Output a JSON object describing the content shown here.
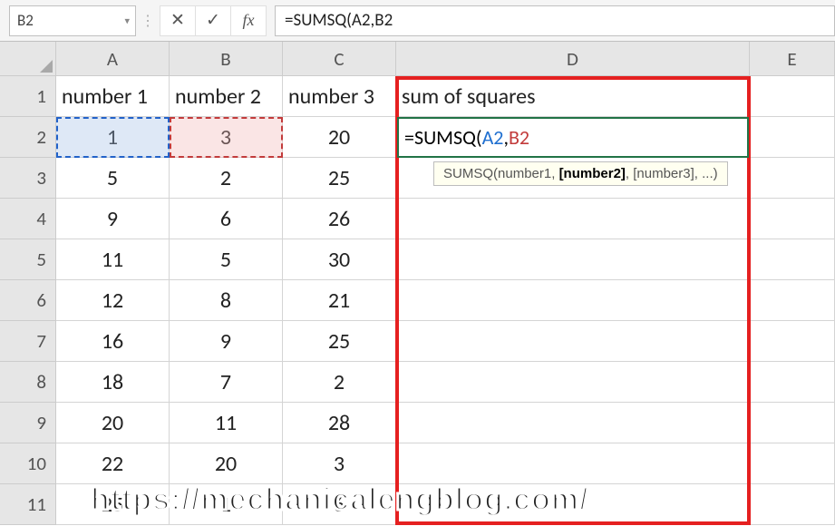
{
  "formula_bar": {
    "name_box": "B2",
    "cancel_glyph": "✕",
    "enter_glyph": "✓",
    "fx_glyph": "fx",
    "formula_text": "=SUMSQ(A2,B2"
  },
  "columns": [
    "A",
    "B",
    "C",
    "D",
    "E"
  ],
  "col_widths": [
    "wA",
    "wB",
    "wC",
    "wD",
    "wE"
  ],
  "rows": [
    "1",
    "2",
    "3",
    "4",
    "5",
    "6",
    "7",
    "8",
    "9",
    "10",
    "11"
  ],
  "header_row": {
    "A": "number 1",
    "B": "number 2",
    "C": "number 3",
    "D": "sum of squares"
  },
  "data_rows": [
    {
      "A": "1",
      "B": "3",
      "C": "20"
    },
    {
      "A": "5",
      "B": "2",
      "C": "25"
    },
    {
      "A": "9",
      "B": "6",
      "C": "26"
    },
    {
      "A": "11",
      "B": "5",
      "C": "30"
    },
    {
      "A": "12",
      "B": "8",
      "C": "21"
    },
    {
      "A": "16",
      "B": "9",
      "C": "25"
    },
    {
      "A": "18",
      "B": "7",
      "C": "2"
    },
    {
      "A": "20",
      "B": "11",
      "C": "28"
    },
    {
      "A": "22",
      "B": "20",
      "C": "3"
    },
    {
      "A": "25",
      "B": "1",
      "C": "6"
    }
  ],
  "active_cell": {
    "prefix": "=SUMSQ(",
    "ref1": "A2",
    "sep": ",",
    "ref2": "B2",
    "ref1_color": "#1f6fd0",
    "ref2_color": "#c23b3b"
  },
  "tooltip": {
    "fn": "SUMSQ",
    "sig_prefix": "(number1, ",
    "sig_bold": "[number2]",
    "sig_suffix": ", [number3], ...)"
  },
  "watermark": "https://mechanicalengblog.com/",
  "chart_data": {
    "type": "table",
    "title": "sum of squares",
    "headers": [
      "number 1",
      "number 2",
      "number 3",
      "sum of squares"
    ],
    "rows": [
      [
        1,
        3,
        20,
        null
      ],
      [
        5,
        2,
        25,
        null
      ],
      [
        9,
        6,
        26,
        null
      ],
      [
        11,
        5,
        30,
        null
      ],
      [
        12,
        8,
        21,
        null
      ],
      [
        16,
        9,
        25,
        null
      ],
      [
        18,
        7,
        2,
        null
      ],
      [
        20,
        11,
        28,
        null
      ],
      [
        22,
        20,
        3,
        null
      ],
      [
        25,
        1,
        6,
        null
      ]
    ],
    "formula_in_progress": "=SUMSQ(A2,B2"
  }
}
